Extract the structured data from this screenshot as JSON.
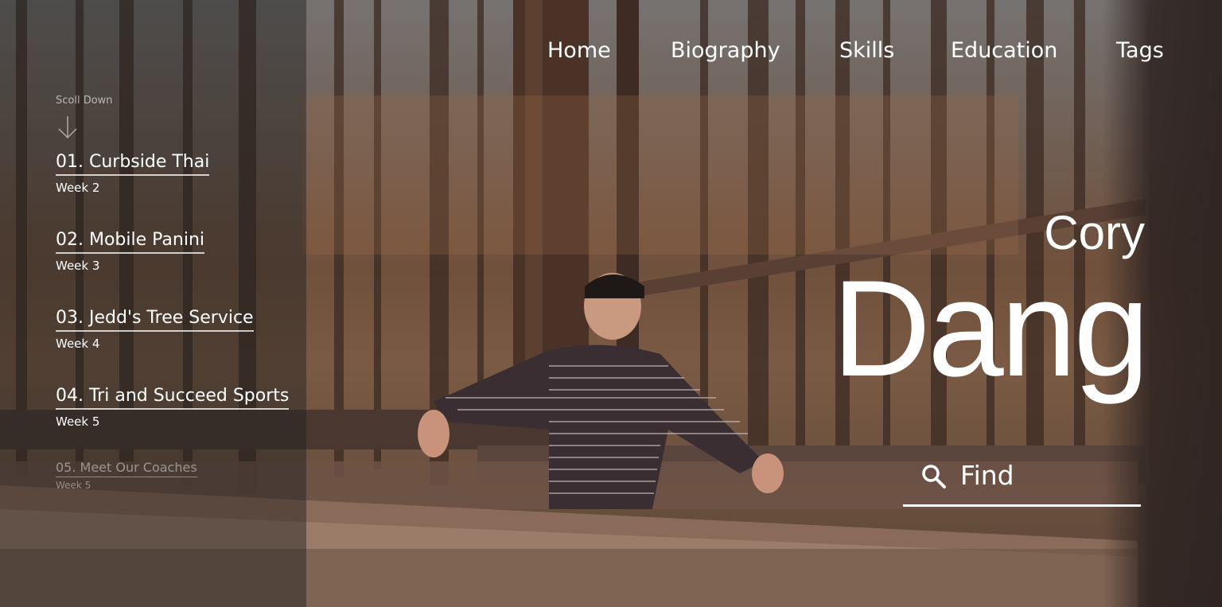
{
  "nav": {
    "items": [
      {
        "label": "Home"
      },
      {
        "label": "Biography"
      },
      {
        "label": "Skills"
      },
      {
        "label": "Education"
      },
      {
        "label": "Tags"
      }
    ]
  },
  "sidebar": {
    "scroll_hint": "Scoll Down",
    "scroll_icon": "arrow-down-icon",
    "items": [
      {
        "title": "01. Curbside Thai",
        "subtitle": "Week 2"
      },
      {
        "title": "02. Mobile Panini",
        "subtitle": "Week 3"
      },
      {
        "title": "03. Jedd's Tree Service",
        "subtitle": "Week 4"
      },
      {
        "title": "04. Tri and Succeed Sports",
        "subtitle": "Week 5"
      },
      {
        "title": "05. Meet Our Coaches",
        "subtitle": "Week 5"
      }
    ]
  },
  "hero": {
    "first_name": "Cory",
    "last_name": "Dang"
  },
  "search": {
    "label": "Find",
    "icon": "search-icon"
  },
  "colors": {
    "text": "#ffffff",
    "panel_overlay": "rgba(30,30,32,0.45)"
  }
}
